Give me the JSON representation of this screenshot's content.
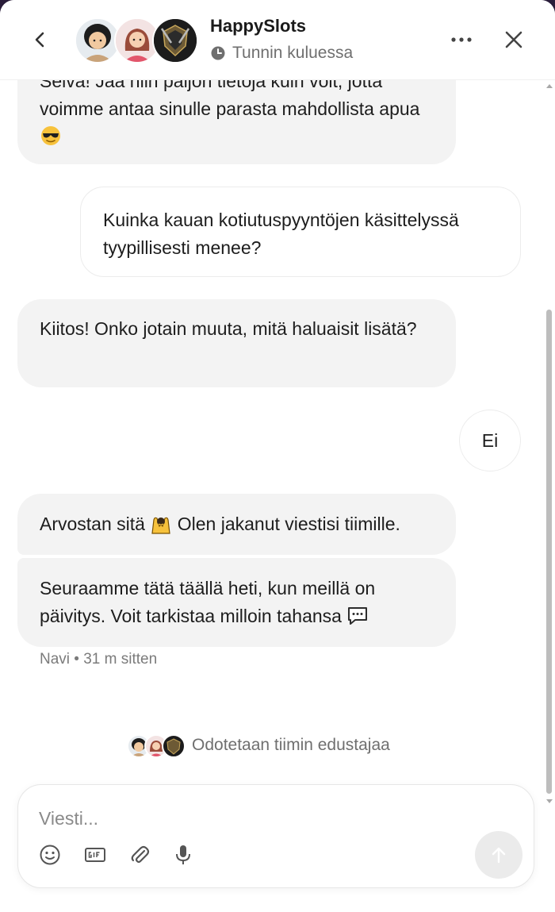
{
  "header": {
    "title": "HappySlots",
    "status": "Tunnin kuluessa"
  },
  "messages": [
    {
      "role": "bot",
      "text": "Selvä! Jaa niin paljon tietoja kuin voit, jotta voimme antaa sinulle parasta mahdollista apua",
      "emoji": "sunglasses-emoji"
    },
    {
      "role": "user",
      "text": "Kuinka kauan kotiutuspyyntöjen käsittelyssä tyypillisesti menee?"
    },
    {
      "role": "bot",
      "text": "Kiitos! Onko jotain muuta, mitä haluaisit lisätä?"
    },
    {
      "role": "user",
      "text": "Ei"
    },
    {
      "role": "bot",
      "text_before": "Arvostan sitä",
      "emoji": "raised-hands-emoji",
      "text_after": "Olen jakanut viestisi tiimille."
    },
    {
      "role": "bot",
      "text": "Seuraamme tätä täällä heti, kun meillä on päivitys. Voit tarkistaa milloin tahansa",
      "emoji": "speech-bubble-emoji"
    }
  ],
  "meta": "Navi • 31 m sitten",
  "waiting": "Odotetaan tiimin edustajaa",
  "composer": {
    "placeholder": "Viesti..."
  },
  "colors": {
    "bot_bubble": "#f3f3f3",
    "user_bubble": "#ffffff",
    "send_button": "#ebebeb"
  }
}
